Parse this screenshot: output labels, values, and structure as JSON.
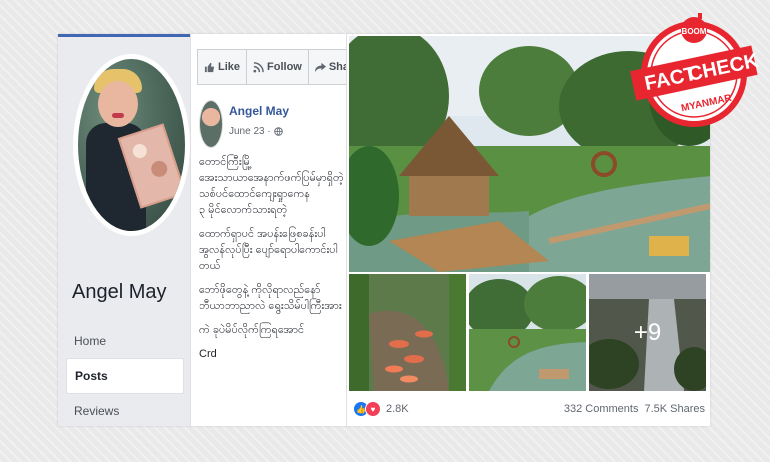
{
  "profile": {
    "name": "Angel May",
    "nav": [
      "Home",
      "Posts",
      "Reviews"
    ],
    "active_nav": "Posts"
  },
  "actions": {
    "like": "Like",
    "follow": "Follow",
    "share": "Share",
    "more": "···"
  },
  "post": {
    "author": "Angel May",
    "date": "June 23 ·",
    "text_lines": [
      "တောင်ကြီးမြို့",
      "အေးသာယာအေနာက်ဖက်ပြမ်မှာရှိတဲ့",
      "သစ်ပင်ထောင်ကျေးရှုာကေန",
      "၃ မိုင်လောက်သားရတဲ့",
      "ထောက်ရှာပင် အပန်းဖြေစခန်းပါ",
      "အွလန်လုပ်ပြီး ပျော်ရောပါကောင်းပါတယ်",
      "ဘော်ဖိုတွေနဲ့ ကိုလိုရာလည်နော်",
      "ဘီယာဘာညာလဲ ရွေးသိမ်ပါကြီးအား",
      "ကဲ ခုပဲမိပ်လိုက်ကြရအောင်"
    ],
    "sign": "Crd"
  },
  "photos": {
    "more_count": "+9"
  },
  "stats": {
    "reactions": "2.8K",
    "comments": "332 Comments",
    "shares": "7.5K Shares"
  },
  "stamp": {
    "brand": "BOOM",
    "line1": "FACT",
    "line2": "CHECK",
    "sub": "MYANMAR",
    "color": "#e8262f"
  }
}
